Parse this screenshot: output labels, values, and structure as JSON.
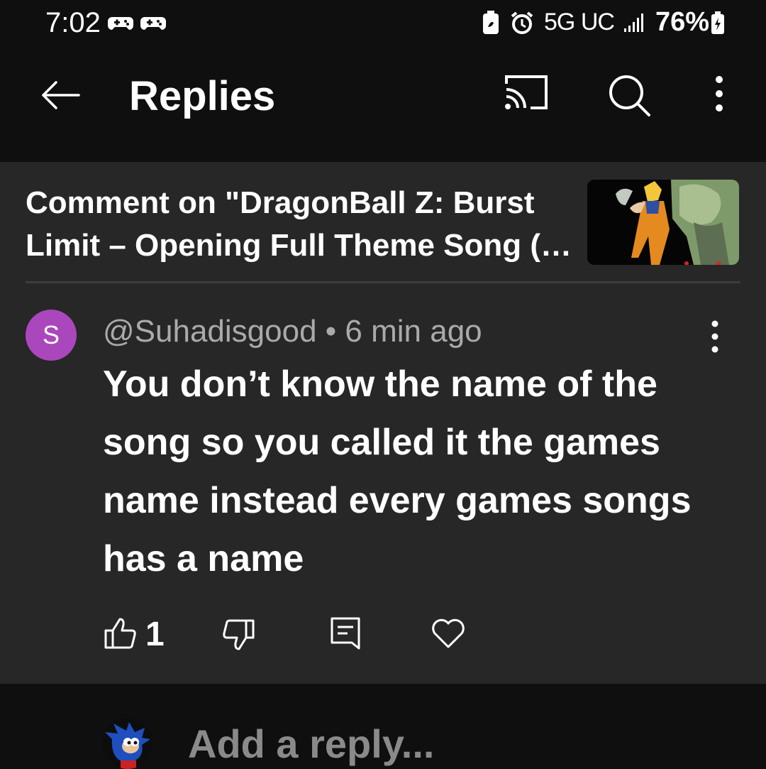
{
  "status_bar": {
    "time": "7:02",
    "network": "5G UC",
    "battery": "76%",
    "icons": [
      "game-controller-icon",
      "game-controller-icon",
      "battery-saver-icon",
      "alarm-icon",
      "signal-icon",
      "battery-icon"
    ]
  },
  "app_bar": {
    "title": "Replies",
    "icons": [
      "back-arrow-icon",
      "cast-icon",
      "search-icon",
      "more-vert-icon"
    ]
  },
  "video": {
    "header_line1": "Comment on \"DragonBall Z: Burst",
    "header_line2": "Limit – Opening Full Theme Song (…"
  },
  "comment": {
    "avatar_letter": "S",
    "avatar_color": "#ab47bc",
    "meta": "@Suhadisgood • 6 min ago",
    "text": "You don’t know the name of the song so you called it the games name instead every games songs has a name",
    "like_count": "1"
  },
  "reply_bar": {
    "placeholder": "Add a reply..."
  },
  "colors": {
    "background": "#0f0f0f",
    "panel": "#272727",
    "secondary_text": "#aaaaaa"
  }
}
